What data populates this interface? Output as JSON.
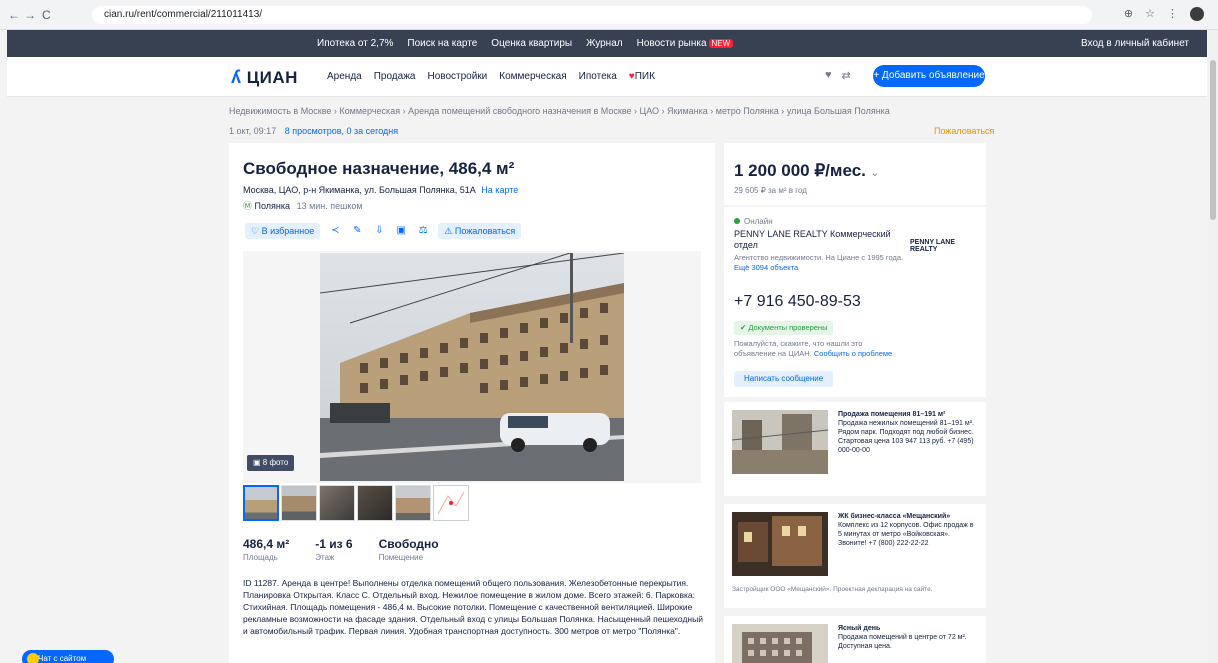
{
  "browser": {
    "back": "←",
    "forward": "→",
    "reload": "C",
    "url": "cian.ru/rent/commercial/211011413/"
  },
  "topbar": {
    "links": [
      "Ипотека от 2,7%",
      "Поиск на карте",
      "Оценка квартиры",
      "Журнал",
      "Новости рынка",
      "NEW"
    ],
    "login": "Вход в личный кабинет"
  },
  "header": {
    "logo": "ЦИАН",
    "nav": [
      "Аренда",
      "Продажа",
      "Новостройки",
      "Коммерческая",
      "Ипотека",
      "ПИК"
    ],
    "add_button": "+ Добавить объявление"
  },
  "breadcrumbs": "Недвижимость в Москве › Коммерческая › Аренда помещений свободного назначения в Москве › ЦАО › Якиманка › метро Полянка › улица Большая Полянка",
  "listing": {
    "date": "1 окт, 09:17",
    "views": "8 просмотров, 0 за сегодня",
    "complain": "Пожаловаться",
    "title": "Свободное назначение, 486,4 м²",
    "address": "Москва, ЦАО, р-н Якиманка, ул. Большая Полянка, 51А",
    "address_link": "На карте",
    "metro": "Полянка",
    "metro_time": "13 мин. пешком",
    "actions": {
      "favorite": "В избранное",
      "report": "Пожаловаться"
    },
    "photo_count": "8 фото",
    "facts": [
      {
        "value": "486,4 м²",
        "label": "Площадь"
      },
      {
        "value": "-1 из 6",
        "label": "Этаж"
      },
      {
        "value": "Свободно",
        "label": "Помещение"
      }
    ],
    "description": "ID 11287. Аренда в центре! Выполнены отделка помещений общего пользования. Железобетонные перекрытия. Планировка Открытая. Класс С. Отдельный вход. Нежилое помещение в жилом доме. Всего этажей: 6. Парковка: Стихийная. Площадь помещения - 486,4 м. Высокие потолки. Помещение с качественной вентиляцией. Широкие рекламные возможности на фасаде здания. Отдельный вход с улицы Большая Полянка. Насыщенный пешеходный и автомобильный трафик. Первая линия. Удобная транспортная доступность. 300 метров от метро \"Полянка\"."
  },
  "price": {
    "value": "1 200 000 ₽/мес.",
    "chevron": "⌄",
    "sub": "29 605 ₽ за м² в год"
  },
  "agent": {
    "status": "Онлайн",
    "name": "PENNY LANE REALTY Коммерческий отдел",
    "logo": "PENNY LANE REALTY",
    "info": "Агентство недвижимости. На Циане с 1995 года.",
    "more": "Ещё 3094 объекта",
    "phone": "+7 916 450-89-53",
    "verified": "Документы проверены",
    "note": "Пожалуйста, скажите, что нашли это объявление на ЦИАН.",
    "note_link": "Сообщить о проблеме",
    "message_button": "Написать сообщение"
  },
  "ads": [
    {
      "title": "Продажа помещения 81–191 м²",
      "text": "Продажа нежилых помещений 81–191 м². Рядом парк. Подходят под любой бизнес. Стартовая цена 103 947 113 руб. +7 (495) 000-00-00"
    },
    {
      "title": "ЖК бизнес-класса «Мещанский»",
      "text": "Комплекс из 12 корпусов. Офис продаж в 5 минутах от метро «Войковская». Звоните! +7 (800) 222-22-22",
      "foot": "Застройщик ООО «Мещанский». Проектная декларация на сайте."
    },
    {
      "title": "Ясный день",
      "text": "Продажа помещений в центре от 72 м². Доступная цена."
    }
  ],
  "chat_button": "Чат с сайтом"
}
